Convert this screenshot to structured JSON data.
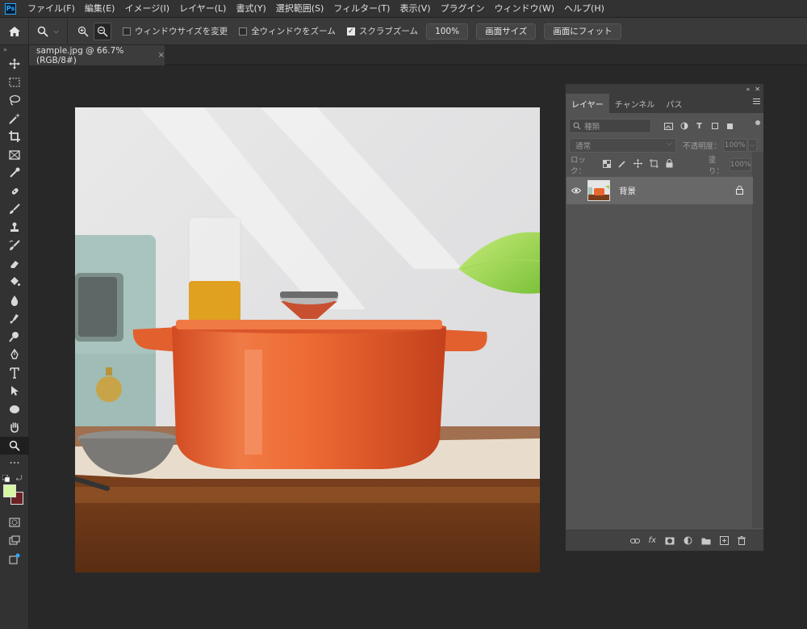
{
  "app": {
    "logo": "Ps"
  },
  "menu": [
    "ファイル(F)",
    "編集(E)",
    "イメージ(I)",
    "レイヤー(L)",
    "書式(Y)",
    "選択範囲(S)",
    "フィルター(T)",
    "表示(V)",
    "プラグイン",
    "ウィンドウ(W)",
    "ヘルプ(H)"
  ],
  "options": {
    "resize_windows": {
      "label": "ウィンドウサイズを変更",
      "checked": false
    },
    "zoom_all": {
      "label": "全ウィンドウをズーム",
      "checked": false
    },
    "scrubby_zoom": {
      "label": "スクラブズーム",
      "checked": true
    },
    "zoom_value": "100%",
    "fit_screen": "画面サイズ",
    "fill_screen": "画面にフィット"
  },
  "document": {
    "tab_title": "sample.jpg @ 66.7% (RGB/8#)",
    "close": "×"
  },
  "toolbar": {
    "tools": [
      "move-icon",
      "marquee-icon",
      "lasso-icon",
      "magic-wand-icon",
      "crop-icon",
      "frame-icon",
      "eyedropper-icon",
      "healing-brush-icon",
      "brush-icon",
      "clone-stamp-icon",
      "history-brush-icon",
      "eraser-icon",
      "paint-bucket-icon",
      "blur-icon",
      "smudge-icon",
      "dodge-icon",
      "pen-icon",
      "type-icon",
      "path-select-icon",
      "ellipse-icon",
      "hand-icon",
      "zoom-icon"
    ],
    "selected": "zoom-icon",
    "foreground_color": "#d7f7a2",
    "background_color": "#6b2227"
  },
  "layers_panel": {
    "tabs": [
      "レイヤー",
      "チャンネル",
      "パス"
    ],
    "active_tab": "レイヤー",
    "search_placeholder": "種類",
    "blend_mode": "通常",
    "opacity_label": "不透明度：",
    "opacity_value": "100%",
    "lock_label": "ロック：",
    "fill_label": "塗り：",
    "fill_value": "100%",
    "layers": [
      {
        "name": "背景",
        "visible": true,
        "locked": true
      }
    ]
  }
}
